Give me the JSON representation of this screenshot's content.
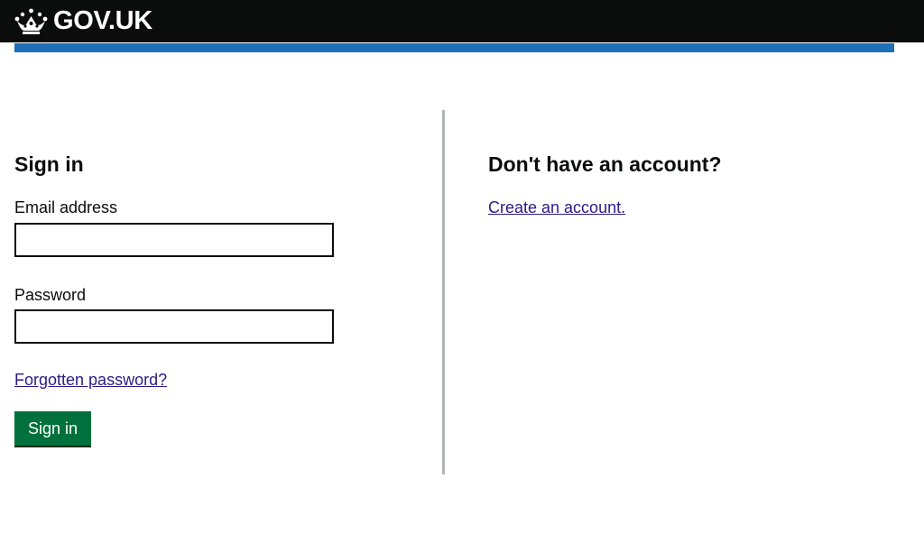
{
  "header": {
    "logo_text": "GOV.UK",
    "logo_icon": "crown-icon",
    "background": "#0b0c0c",
    "accent_bar_color": "#1d70b8"
  },
  "sign_in": {
    "heading": "Sign in",
    "email_label": "Email address",
    "email_value": "",
    "password_label": "Password",
    "password_value": "",
    "forgotten_link": "Forgotten password?",
    "submit_label": "Sign in",
    "submit_color": "#00703c"
  },
  "register": {
    "heading": "Don't have an account?",
    "create_link": "Create an account."
  }
}
